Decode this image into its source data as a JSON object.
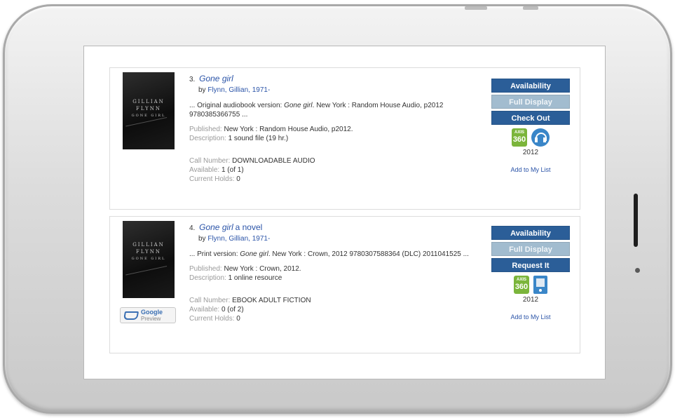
{
  "records": [
    {
      "number": "3.",
      "title": "Gone girl",
      "title_rest": "",
      "by_prefix": "by",
      "author": "Flynn, Gillian, 1971-",
      "snippet_prefix": "... Original audiobook version:",
      "snippet_title": "Gone girl",
      "snippet_rest": ". New York : Random House Audio, p2012 9780385366755 ...",
      "published_label": "Published:",
      "published_value": "New York : Random House Audio, p2012.",
      "description_label": "Description:",
      "description_value": "1 sound file (19 hr.)",
      "call_label": "Call Number:",
      "call_value": "DOWNLOADABLE AUDIO",
      "available_label": "Available:",
      "available_value": "1 (of 1)",
      "holds_label": "Current Holds:",
      "holds_value": "0",
      "buttons": {
        "availability": "Availability",
        "full_display": "Full Display",
        "action": "Check Out"
      },
      "axis_badge": {
        "top": "AXIS",
        "num": "360"
      },
      "format_icon": "audiobook-headphones-icon",
      "year": "2012",
      "add_to_list": "Add to My List",
      "cover": {
        "author": "GILLIAN",
        "surname": "FLYNN",
        "title": "GONE GIRL"
      }
    },
    {
      "number": "4.",
      "title": "Gone girl",
      "title_rest": "a novel",
      "by_prefix": "by",
      "author": "Flynn, Gillian, 1971-",
      "snippet_prefix": "... Print version:",
      "snippet_title": "Gone girl",
      "snippet_rest": ". New York : Crown, 2012 9780307588364 (DLC) 2011041525 ...",
      "published_label": "Published:",
      "published_value": "New York : Crown, 2012.",
      "description_label": "Description:",
      "description_value": "1 online resource",
      "call_label": "Call Number:",
      "call_value": "EBOOK ADULT FICTION",
      "available_label": "Available:",
      "available_value": "0 (of 2)",
      "holds_label": "Current Holds:",
      "holds_value": "0",
      "buttons": {
        "availability": "Availability",
        "full_display": "Full Display",
        "action": "Request It"
      },
      "axis_badge": {
        "top": "AXIS",
        "num": "360"
      },
      "format_icon": "ebook-tablet-icon",
      "year": "2012",
      "add_to_list": "Add to My List",
      "cover": {
        "author": "GILLIAN",
        "surname": "FLYNN",
        "title": "GONE GIRL"
      },
      "google_preview": {
        "brand": "Google",
        "label": "Preview"
      }
    }
  ],
  "colors": {
    "button_primary": "#2b5e98",
    "button_disabled": "#a2bccf",
    "link": "#2b54a8",
    "axis360_green": "#7bb53b",
    "format_icon_blue": "#3a86c8"
  }
}
